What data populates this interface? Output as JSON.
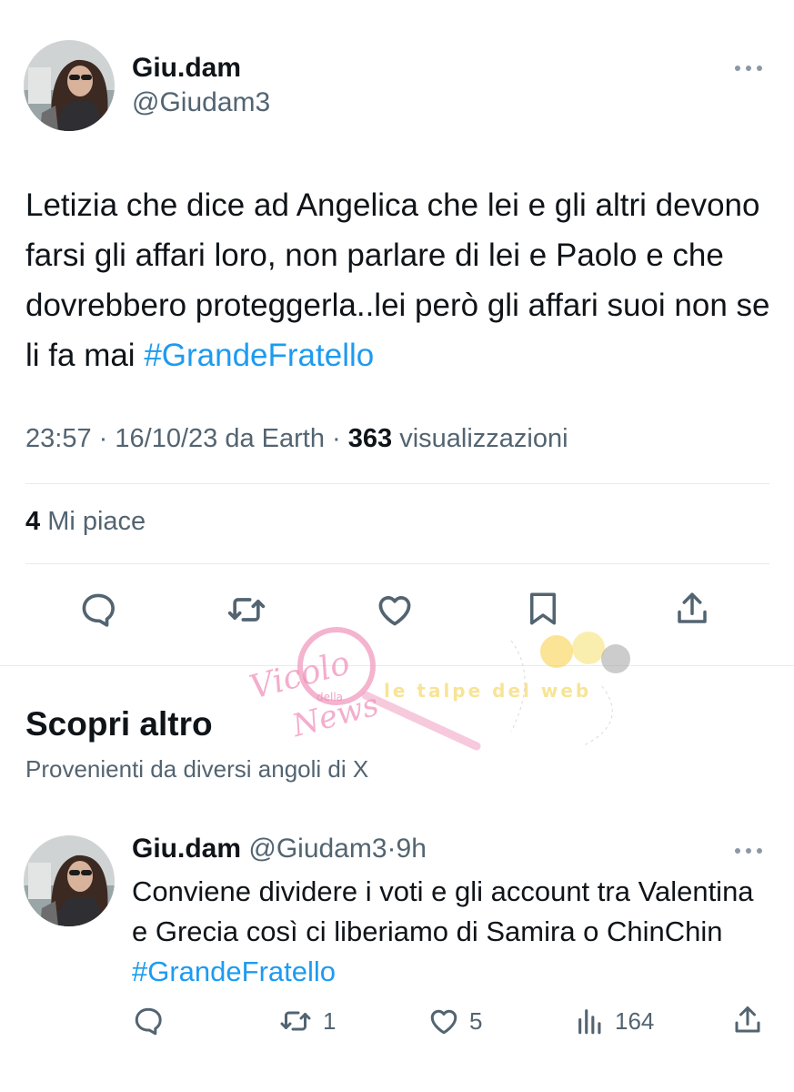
{
  "main_tweet": {
    "author_name": "Giu.dam",
    "author_handle": "@Giudam3",
    "more_icon": "more-dots-icon",
    "text": "Letizia che dice ad Angelica che lei e gli altri devono farsi gli affari loro, non parlare di lei e Paolo e che dovrebbero proteggerla..lei però gli affari suoi non se li fa mai ",
    "hashtag": "#GrandeFratello",
    "time": "23:57",
    "separator": "·",
    "date_source": "16/10/23 da Earth",
    "views_count": "363",
    "views_label": "visualizzazioni",
    "likes_count": "4",
    "likes_label": "Mi piace",
    "actions": [
      "reply-icon",
      "retweet-icon",
      "like-icon",
      "bookmark-icon",
      "share-icon"
    ]
  },
  "discover": {
    "title": "Scopri altro",
    "subtitle": "Provenienti da diversi angoli di X"
  },
  "suggested_tweet": {
    "author_name": "Giu.dam",
    "author_handle": "@Giudam3",
    "age": "9h",
    "separator": "·",
    "text": "Conviene dividere i voti e gli account tra Valentina e Grecia così ci liberiamo di Samira o ChinChin ",
    "hashtag": "#GrandeFratello",
    "retweets": "1",
    "likes": "5",
    "views": "164"
  },
  "watermark": {
    "logo_text_1": "Vicolo",
    "logo_text_2": "della",
    "logo_text_3": "News",
    "banner_text": "le talpe del web"
  },
  "colors": {
    "text": "#0f1419",
    "secondary": "#536471",
    "accent": "#1d9bf0",
    "divider": "#e6ecf0"
  }
}
